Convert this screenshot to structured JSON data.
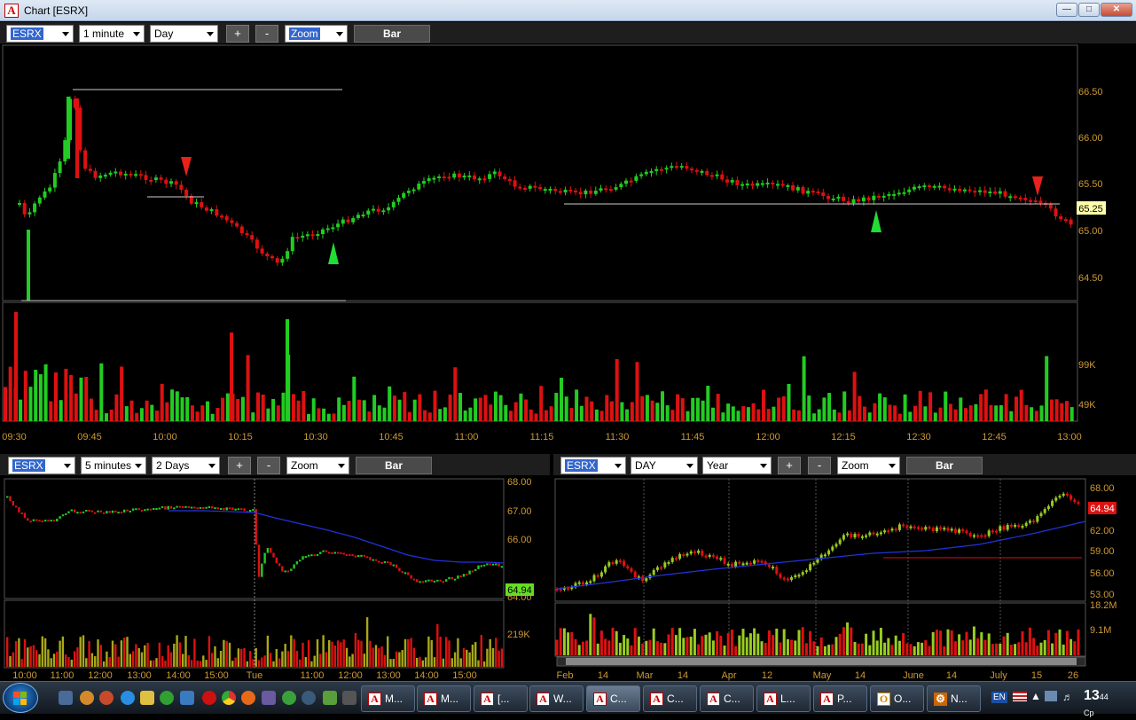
{
  "window": {
    "title": "Chart [ESRX]",
    "app_icon": "A"
  },
  "main": {
    "symbol": "ESRX",
    "interval": "1 minute",
    "range": "Day",
    "plus": "+",
    "minus": "-",
    "mode": "Zoom",
    "style": "Bar",
    "price_axis": [
      "66.50",
      "66.00",
      "65.50",
      "65.00",
      "64.50"
    ],
    "current_price": "65.25",
    "volume_axis": [
      "99K",
      "49K"
    ],
    "time_axis": [
      "09:30",
      "09:45",
      "10:00",
      "10:15",
      "10:30",
      "10:45",
      "11:00",
      "11:15",
      "11:30",
      "11:45",
      "12:00",
      "12:15",
      "12:30",
      "12:45",
      "13:00"
    ]
  },
  "left": {
    "symbol": "ESRX",
    "interval": "5 minutes",
    "range": "2 Days",
    "plus": "+",
    "minus": "-",
    "mode": "Zoom",
    "style": "Bar",
    "price_axis": [
      "68.00",
      "67.00",
      "66.00",
      "65.00",
      "64.00"
    ],
    "current_price": "64.94",
    "volume_axis": [
      "219K"
    ],
    "time_axis": [
      "10:00",
      "11:00",
      "12:00",
      "13:00",
      "14:00",
      "15:00",
      "Tue",
      "11:00",
      "12:00",
      "13:00",
      "14:00",
      "15:00"
    ]
  },
  "right": {
    "symbol": "ESRX",
    "interval": "DAY",
    "range": "Year",
    "plus": "+",
    "minus": "-",
    "mode": "Zoom",
    "style": "Bar",
    "price_axis": [
      "68.00",
      "65.00",
      "62.00",
      "59.00",
      "56.00",
      "53.00"
    ],
    "current_price": "64.94",
    "volume_axis": [
      "18.2M",
      "9.1M"
    ],
    "time_axis": [
      "Feb",
      "14",
      "Mar",
      "14",
      "Apr",
      "12",
      "May",
      "14",
      "June",
      "14",
      "July",
      "15",
      "26"
    ]
  },
  "taskbar": {
    "buttons": [
      "M...",
      "M...",
      "[...",
      "W...",
      "C...",
      "C...",
      "C...",
      "L...",
      "P...",
      "O...",
      "N..."
    ],
    "language": "EN",
    "clock": "13",
    "clock_minutes": "44",
    "clock_suffix": "Cp"
  },
  "colors": {
    "up": "#22cc22",
    "down": "#dd1111",
    "axis_text": "#cc9933",
    "grid": "#444444",
    "ma": "#2233dd"
  }
}
